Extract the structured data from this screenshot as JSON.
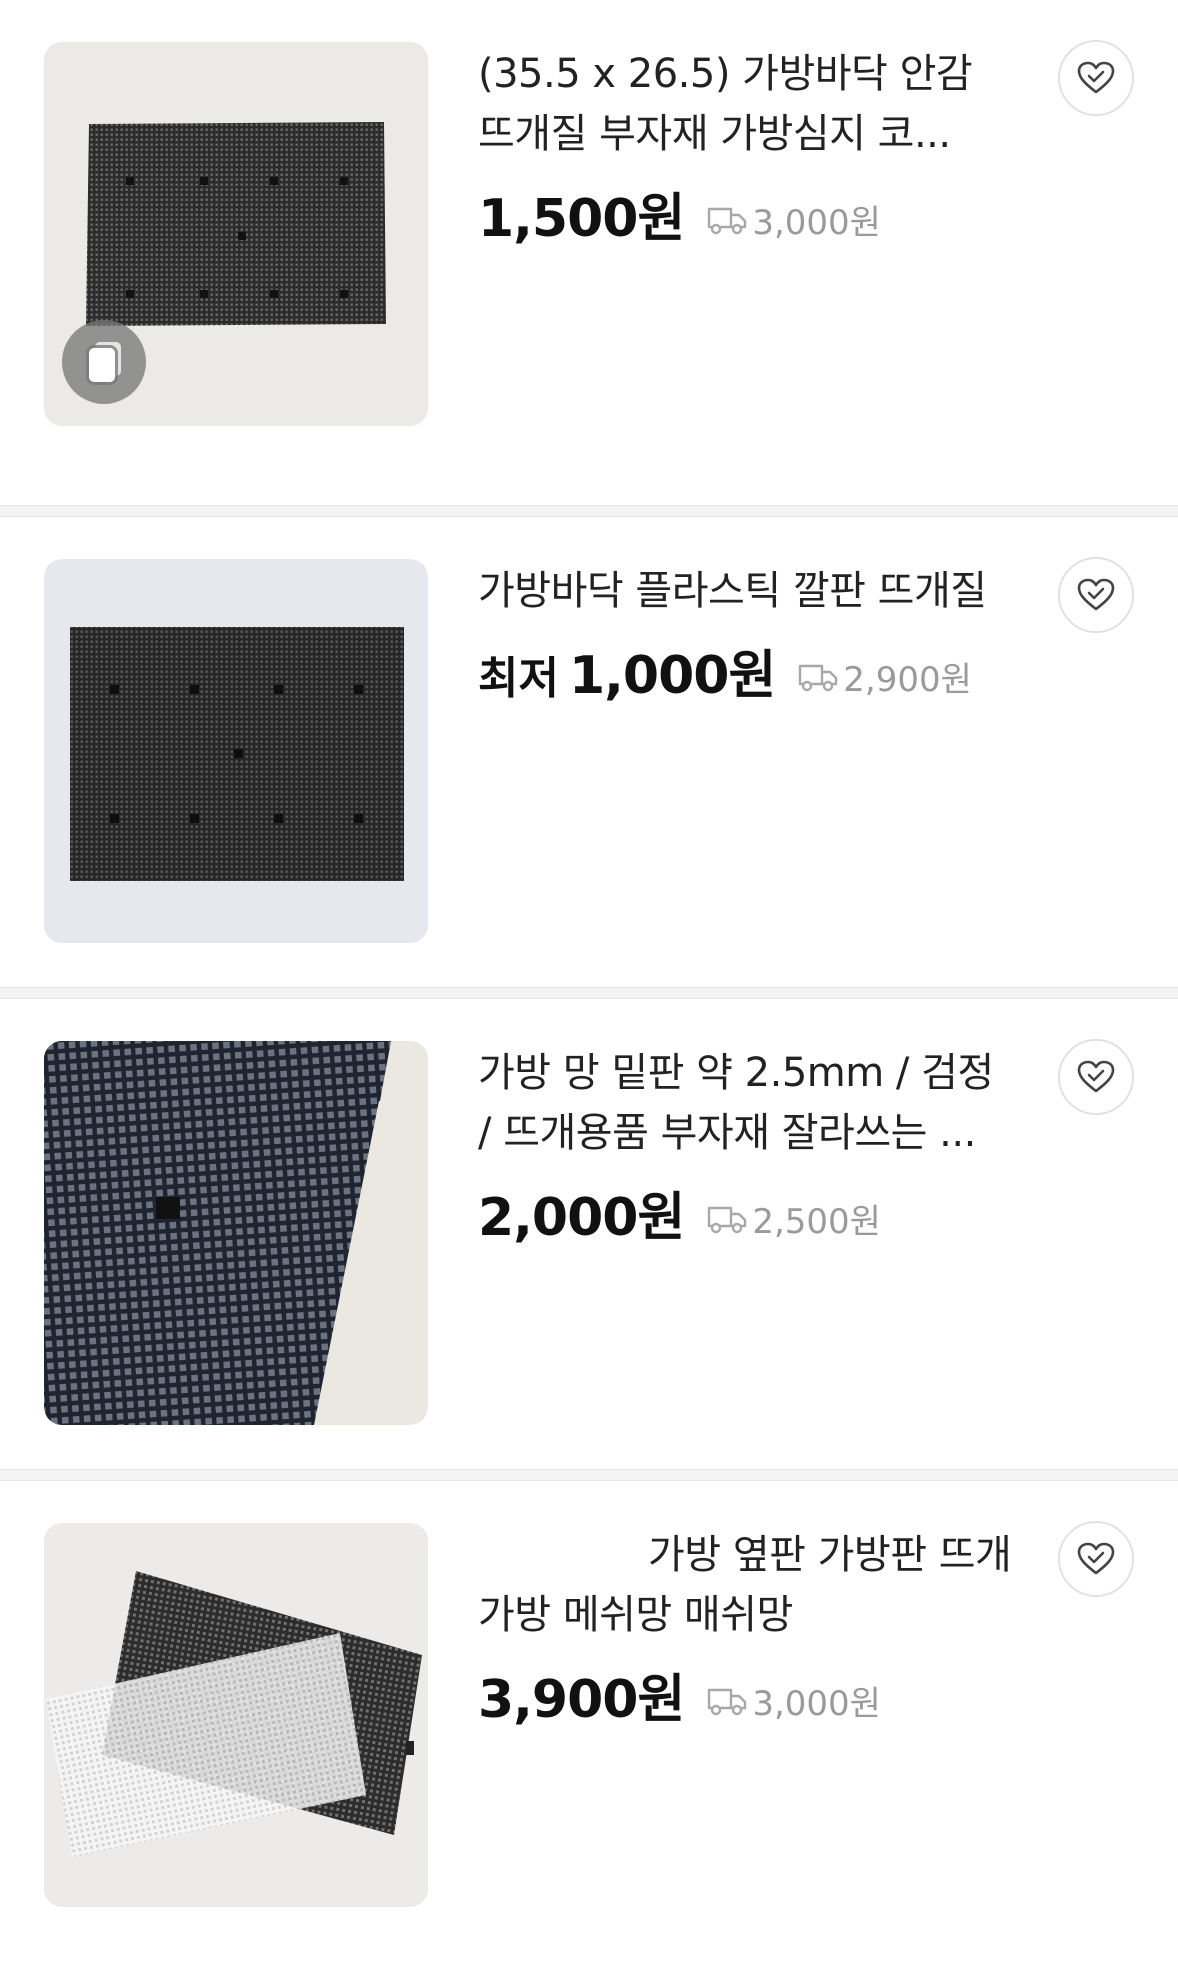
{
  "products": [
    {
      "title": "(35.5 x 26.5) 가방바닥 안감 뜨개질 부자재 가방심지 코...",
      "price_prefix": "",
      "price": "1,500원",
      "shipping": "3,000원",
      "image_icon": "multi-image-icon",
      "bg": "#eceae7"
    },
    {
      "title": "가방바닥 플라스틱 깔판 뜨개질",
      "price_prefix": "최저",
      "price": "1,000원",
      "shipping": "2,900원",
      "bg": "#e7e8ee"
    },
    {
      "title": "가방 망 밑판 약 2.5mm / 검정 / 뜨개용품 부자재 잘라쓰는 ...",
      "price_prefix": "",
      "price": "2,000원",
      "shipping": "2,500원",
      "bg": "#ebe8e1"
    },
    {
      "title": "가방 옆판 가방판 뜨개가방 메쉬망 매쉬망",
      "price_prefix": "",
      "price": "3,900원",
      "shipping": "3,000원",
      "bg": "#ecebea"
    }
  ],
  "icons": {
    "wishlist": "heart-check-icon",
    "shipping": "delivery-truck-icon"
  },
  "colors": {
    "price": "#111111",
    "shipping_text": "#9a9a9a",
    "separator": "#f3f4f6"
  }
}
